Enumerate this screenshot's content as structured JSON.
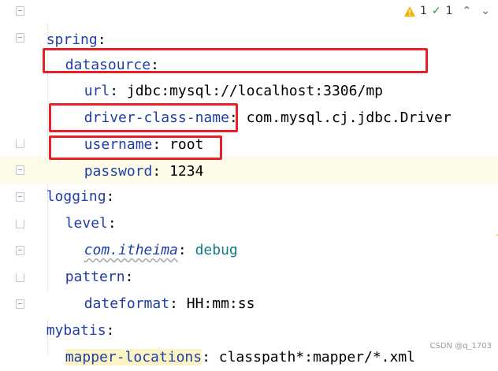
{
  "status": {
    "warnings": "1",
    "checks": "1",
    "up_arrow": "⌃",
    "down_arrow": "⌄"
  },
  "lines": {
    "spring": {
      "key": "spring",
      "colon": ":"
    },
    "datasource": {
      "key": "datasource",
      "colon": ":"
    },
    "url": {
      "key": "url",
      "colon": ":",
      "value": " jdbc:mysql://localhost:3306/mp"
    },
    "driver": {
      "key": "driver-class-name",
      "colon": ":",
      "value": " com.mysql.cj.jdbc.Driver"
    },
    "username": {
      "key": "username",
      "colon": ":",
      "value": " root"
    },
    "password": {
      "key": "password",
      "colon": ":",
      "value": " 1234"
    },
    "logging": {
      "key": "logging",
      "colon": ":"
    },
    "level": {
      "key": "level",
      "colon": ":"
    },
    "itheima": {
      "key": "com.itheima",
      "colon": ":",
      "value": " debug"
    },
    "pattern": {
      "key": "pattern",
      "colon": ":"
    },
    "dateformat": {
      "key": "dateformat",
      "colon": ":",
      "value": " HH:mm:ss"
    },
    "mybatis": {
      "key": "mybatis",
      "colon": ":"
    },
    "mapper": {
      "key": "mapper-locations",
      "colon": ":",
      "value": " classpath*:mapper/*.xml"
    }
  },
  "watermark": "CSDN @q_1703",
  "colors": {
    "key": "#1f3ea8",
    "highlight_box": "#e8202a",
    "line_highlight": "#fdfce8",
    "teal_value": "#0f7c87"
  }
}
